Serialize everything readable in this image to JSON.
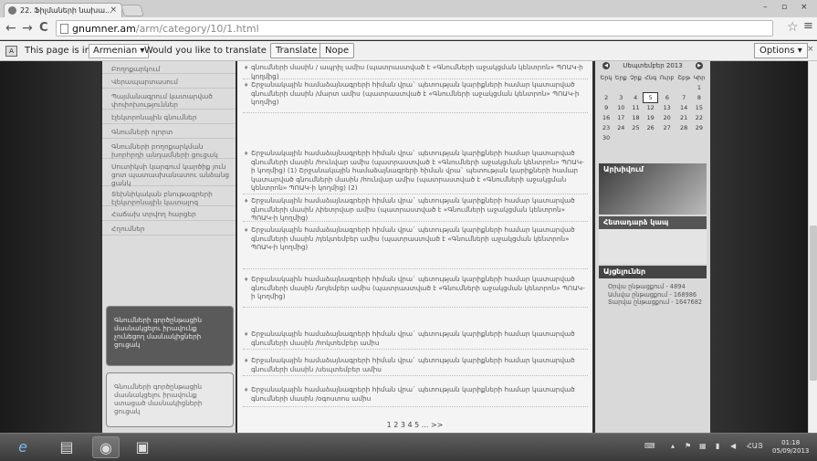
{
  "browser": {
    "tab_title": "22. Ֆիլմաների նախա...",
    "url_host": "gnumner.am",
    "url_path": "/arm/category/10/1.html",
    "win_min": "–",
    "win_max": "▫",
    "win_close": "×"
  },
  "translate": {
    "text1": "This page is in",
    "language": "Armenian ▾",
    "text2": "Would you like to translate it?",
    "translate_btn": "Translate",
    "nope_btn": "Nope",
    "options_btn": "Options ▾",
    "close": "×"
  },
  "nav": {
    "items": [
      "Բողոքարկում",
      "Վերապարտասում",
      "Պայմանագրում կատարված փոփոխություններ",
      "էլեկտրոնային գնումներ",
      "Գնումների ոլորտ",
      "Գնումների բողոքարկման խորհրդի անդամների ցուցակ",
      "Սուտիկսի կարգում կարծիք յուն ցոտ պատասխանատու անձանց ցանկ",
      "Տեխնիկական բնութագրերի էլեկտրոնային կատալոգ",
      "Հաճախ տրվող հարցեր",
      "Հղումներ"
    ],
    "promo1": "Գնումների գործընթացին մասնակցելու իրավունք չունեցող մասնակիցների ցուցակ",
    "promo2": "Գնումների գործընթացին մասնակցելու իրավունք ստացած մասնակիցների ցուցակ"
  },
  "main": {
    "entries": [
      "գնումների մասին / ապրիլ ամիս (պատրաստված է «Գնումների աջակցման կենտրոն» ՊՈԱԿ-ի կողմից)",
      "Շրջանակային համաձայնագրերի հիման վրա` պետության կարիքների համար կատարված գնումների մասին /մարտ ամիս (պատրաստված է «Գնումների աջակցման կենտրոն» ՊՈԱԿ-ի կողմից)",
      "Շրջանակային համաձայնագրերի հիման վրա` պետության կարիքների համար կատարված գնումների մասին /հունվար ամիս (պատրաստված է «Գնումների աջակցման կենտրոն» ՊՈԱԿ-ի կողմից) (1) Շրջանակային համաձայնագրերի հիման վրա` պետության կարիքների համար կատարված գնումների մասին /հունվար ամիս (պատրաստված է «Գնումների աջակցման կենտրոն» ՊՈԱԿ-ի կողմից) (2)",
      "Շրջանակային համաձայնագրերի հիման վրա` պետության կարիքների համար կատարված գնումների մասին /փետրվար ամիս (պատրաստված է «Գնումների աջակցման կենտրոն» ՊՈԱԿ-ի կողմից)",
      "Շրջանակային համաձայնագրերի հիման վրա` պետության կարիքների համար կատարված գնումների մասին /դեկտեմբեր ամիս (պատրաստված է «Գնումների աջակցման կենտրոն» ՊՈԱԿ-ի կողմից)",
      "Շրջանակային համաձայնագրերի հիման վրա` պետության կարիքների համար կատարված գնումների մասին /նոյեմբեր ամիս (պատրաստված է «Գնումների աջակցման կենտրոն» ՊՈԱԿ-ի կողմից)",
      "Շրջանակային համաձայնագրերի հիման վրա` պետության կարիքների համար կատարված գնումների մասին /հոկտեմբեր ամիս",
      "Շրջանակային համաձայնագրերի հիման վրա` պետության կարիքների համար կատարված գնումների մասին /սեպտեմբեր ամիս",
      "Շրջանակային համաձայնագրերի հիման վրա` պետության կարիքների համար կատարված գնումների մասին /օգոստոս ամիս"
    ],
    "pager": "1 2 3 4 5 ... >>"
  },
  "right": {
    "cal_title": "Սեպտեմբեր 2013",
    "cal_days": [
      "Երկ",
      "Երք",
      "Չրք",
      "Հնգ",
      "Ուրբ",
      "Շբթ",
      "Կիր"
    ],
    "cal_weeks": [
      [
        "",
        "",
        "",
        "",
        "",
        "",
        "1"
      ],
      [
        "2",
        "3",
        "4",
        "5",
        "6",
        "7",
        "8"
      ],
      [
        "9",
        "10",
        "11",
        "12",
        "13",
        "14",
        "15"
      ],
      [
        "16",
        "17",
        "18",
        "19",
        "20",
        "21",
        "22"
      ],
      [
        "23",
        "24",
        "25",
        "26",
        "27",
        "28",
        "29"
      ],
      [
        "30",
        "",
        "",
        "",
        "",
        "",
        ""
      ]
    ],
    "cal_today": "5",
    "ads_title": "Արխիվում",
    "feedback_title": "Հետադարձ կապ",
    "stats_title": "Այցելուներ",
    "stats": [
      "Օրվա ընթացքում - 4894",
      "Ամսվա ընթացքում - 168986",
      "Տարվա ընթացքում - 1647682"
    ]
  },
  "taskbar": {
    "lang": "ՀԱՅ",
    "time": "01:18",
    "date": "05/09/2013"
  }
}
